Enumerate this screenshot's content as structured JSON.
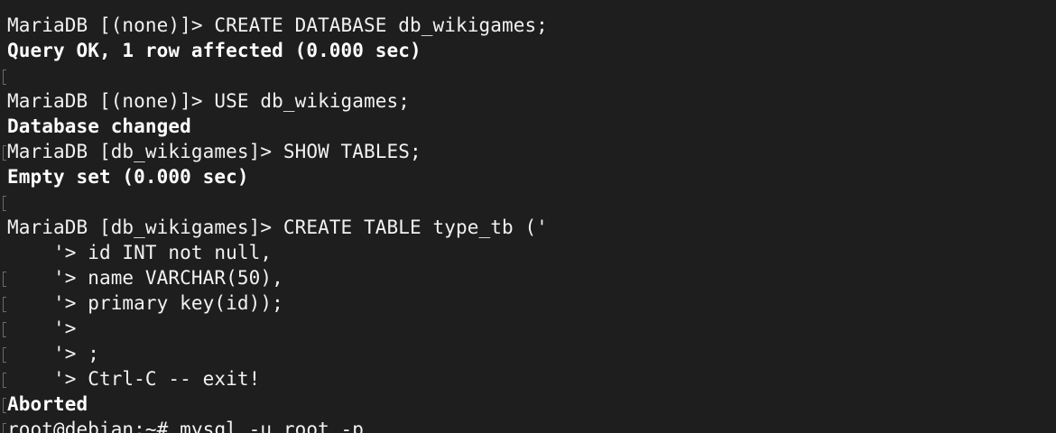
{
  "terminal": {
    "lines": [
      {
        "text": "MariaDB [(none)]> CREATE DATABASE db_wikigames;",
        "bold": false
      },
      {
        "text": "Query OK, 1 row affected (0.000 sec)",
        "bold": true
      },
      {
        "text": "",
        "bold": false
      },
      {
        "text": "MariaDB [(none)]> USE db_wikigames;",
        "bold": false
      },
      {
        "text": "Database changed",
        "bold": true
      },
      {
        "text": "MariaDB [db_wikigames]> SHOW TABLES;",
        "bold": false
      },
      {
        "text": "Empty set (0.000 sec)",
        "bold": true
      },
      {
        "text": "",
        "bold": false
      },
      {
        "text": "MariaDB [db_wikigames]> CREATE TABLE type_tb ('",
        "bold": false
      },
      {
        "text": "    '> id INT not null,",
        "bold": false
      },
      {
        "text": "    '> name VARCHAR(50),",
        "bold": false
      },
      {
        "text": "    '> primary key(id));",
        "bold": false
      },
      {
        "text": "    '>",
        "bold": false
      },
      {
        "text": "    '> ;",
        "bold": false
      },
      {
        "text": "    '> Ctrl-C -- exit!",
        "bold": false
      },
      {
        "text": "Aborted",
        "bold": true
      },
      {
        "text": "root@debian:~# mysql -u root -p",
        "bold": false
      }
    ],
    "marks": [
      2,
      5,
      7,
      10,
      11,
      12,
      13,
      14,
      15,
      16
    ]
  }
}
